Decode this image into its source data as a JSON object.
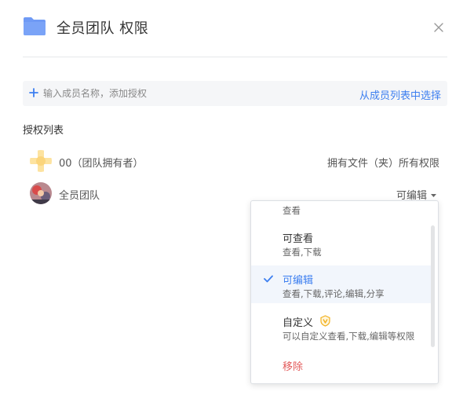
{
  "dialog": {
    "title": "全员团队 权限"
  },
  "invite": {
    "placeholder": "输入成员名称，添加授权",
    "pick_from_list": "从成员列表中选择"
  },
  "auth_list": {
    "title": "授权列表",
    "members": [
      {
        "name": "00（团队拥有者）",
        "permission": "拥有文件（夹）所有权限"
      },
      {
        "name": "全员团队",
        "permission": "可编辑"
      }
    ]
  },
  "permission_menu": {
    "items": [
      {
        "label": "",
        "desc": "查看"
      },
      {
        "label": "可查看",
        "desc": "查看,下载"
      },
      {
        "label": "可编辑",
        "desc": "查看,下载,评论,编辑,分享",
        "selected": true
      },
      {
        "label": "自定义",
        "desc": "可以自定义查看,下载,编辑等权限"
      },
      {
        "label": "移除",
        "desc": ""
      }
    ]
  },
  "colors": {
    "accent": "#3d7ff0",
    "danger": "#e35b5b",
    "folder": "#6f9af5",
    "badge": "#f2b01e"
  }
}
